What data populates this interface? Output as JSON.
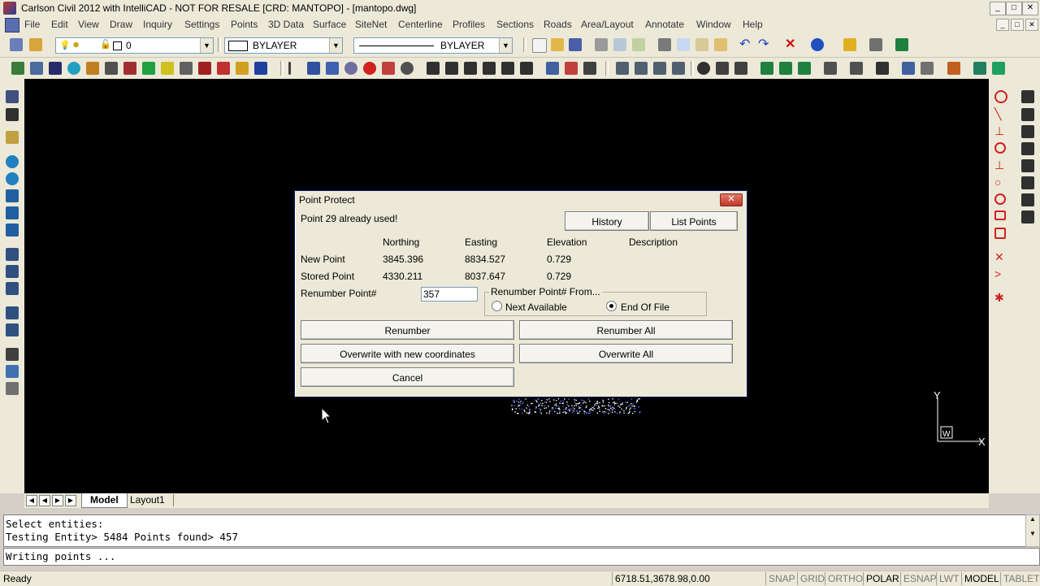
{
  "window": {
    "title": "Carlson Civil 2012 with IntelliCAD - NOT FOR RESALE [CRD: MANTOPO] - [mantopo.dwg]",
    "controls": [
      "_",
      "□",
      "✕"
    ]
  },
  "menu": [
    "File",
    "Edit",
    "View",
    "Draw",
    "Inquiry",
    "Settings",
    "Points",
    "3D Data",
    "Surface",
    "SiteNet",
    "Centerline",
    "Profiles",
    "Sections",
    "Roads",
    "Area/Layout",
    "Annotate",
    "Window",
    "Help"
  ],
  "doc_controls": [
    "_",
    "□",
    "✕"
  ],
  "toolbar": {
    "layer_value": "0",
    "color_value": "BYLAYER",
    "linetype_value": "BYLAYER"
  },
  "tabs": {
    "model": "Model",
    "layout": "Layout1"
  },
  "command_lines": [
    "Select entities:",
    "Testing Entity> 5484  Points found> 457"
  ],
  "command_input": "Writing points ...",
  "status": {
    "ready": "Ready",
    "coords": "6718.51,3678.98,0.00",
    "toggles": [
      {
        "label": "SNAP",
        "on": false
      },
      {
        "label": "GRID",
        "on": false
      },
      {
        "label": "ORTHO",
        "on": false
      },
      {
        "label": "POLAR",
        "on": true
      },
      {
        "label": "ESNAP",
        "on": false
      },
      {
        "label": "LWT",
        "on": false
      },
      {
        "label": "MODEL",
        "on": true
      },
      {
        "label": "TABLET",
        "on": false
      }
    ]
  },
  "ucs": {
    "x": "X",
    "y": "Y",
    "w": "W"
  },
  "dialog": {
    "title": "Point Protect",
    "message": "Point 29 already used!",
    "history_btn": "History",
    "list_points_btn": "List Points",
    "headers": {
      "northing": "Northing",
      "easting": "Easting",
      "elevation": "Elevation",
      "description": "Description"
    },
    "new_point": {
      "label": "New Point",
      "northing": "3845.396",
      "easting": "8834.527",
      "elevation": "0.729"
    },
    "stored_point": {
      "label": "Stored Point",
      "northing": "4330.211",
      "easting": "8037.647",
      "elevation": "0.729"
    },
    "renumber_label": "Renumber Point#",
    "renumber_value": "357",
    "renumber_from_label": "Renumber Point# From...",
    "radio_next": "Next Available",
    "radio_end": "End Of File",
    "radio_selected": "End Of File",
    "btn_renumber": "Renumber",
    "btn_renumber_all": "Renumber All",
    "btn_overwrite": "Overwrite with new coordinates",
    "btn_overwrite_all": "Overwrite All",
    "btn_cancel": "Cancel"
  }
}
